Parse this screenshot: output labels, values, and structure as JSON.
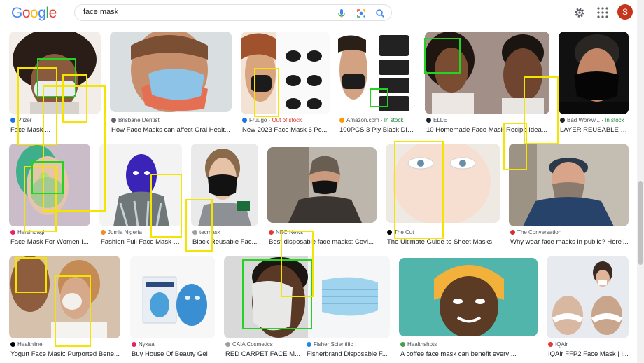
{
  "header": {
    "logo": [
      "G",
      "o",
      "o",
      "g",
      "l",
      "e"
    ],
    "logo_colors": [
      "#4285f4",
      "#ea4335",
      "#fbbc05",
      "#4285f4",
      "#34a853",
      "#ea4335"
    ],
    "search_value": "face mask",
    "avatar_letter": "S",
    "icons": [
      "mic-icon",
      "lens-icon",
      "search-icon",
      "gear-icon",
      "apps-icon"
    ]
  },
  "results": [
    {
      "source": "Pfizer",
      "title": "Face Mask ...",
      "color": "#1a73e8"
    },
    {
      "source": "Brisbane Dentist",
      "title": "How Face Masks can affect Oral Healt...",
      "color": "#5f6368"
    },
    {
      "source": "Fruugo",
      "stock": "Out of stock",
      "title": "New 2023 Face Mask 6 Pc...",
      "color": "#1a73e8"
    },
    {
      "source": "Amazon.com",
      "stock": "In stock",
      "title": "100PCS 3 Ply Black Dis...",
      "color": "#ff9900"
    },
    {
      "source": "ELLE",
      "title": "10 Homemade Face Mask Recipe Idea...",
      "color": "#202124"
    },
    {
      "source": "Bad Workw...",
      "stock": "In stock",
      "title": "LAYER REUSABLE H...",
      "color": "#202124"
    },
    {
      "source": "Herzindagi",
      "title": "Face Mask For Women I...",
      "color": "#e91e63"
    },
    {
      "source": "Jumia Nigeria",
      "title": "Fashion Full Face Mask F...",
      "color": "#f68b1e"
    },
    {
      "source": "tecmask",
      "title": "Black Reusable Fac...",
      "color": "#9e9e9e"
    },
    {
      "source": "NBC News",
      "title": "Best disposable face masks: Covi...",
      "color": "#e53935"
    },
    {
      "source": "The Cut",
      "title": "The Ultimate Guide to Sheet Masks",
      "color": "#000000"
    },
    {
      "source": "The Conversation",
      "title": "Why wear face masks in public? Here'...",
      "color": "#d32f2f"
    },
    {
      "source": "Healthline",
      "title": "Yogurt Face Mask: Purported Bene...",
      "color": "#000000"
    },
    {
      "source": "Nykaa",
      "title": "Buy House Of Beauty Gel ...",
      "color": "#e91e63"
    },
    {
      "source": "CAIA Cosmetics",
      "title": "RED CARPET FACE M...",
      "color": "#9e9e9e"
    },
    {
      "source": "Fisher Scientific",
      "title": "Fisherbrand Disposable F...",
      "color": "#1e88e5"
    },
    {
      "source": "Healthshots",
      "title": "A coffee face mask can benefit every ...",
      "color": "#43a047"
    },
    {
      "source": "IQAir",
      "title": "IQAir FFP2 Face Mask | I...",
      "color": "#e53935"
    }
  ]
}
